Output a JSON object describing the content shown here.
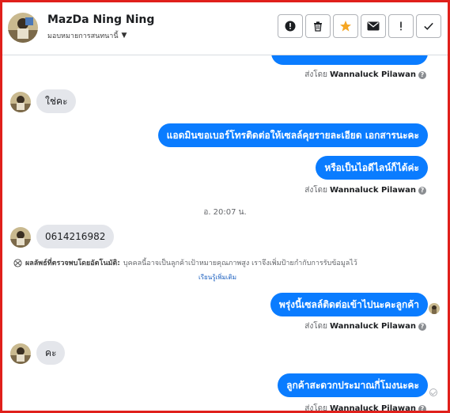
{
  "header": {
    "name": "MazDa Ning Ning",
    "subtitle": "มอบหมายการสนทนานี้",
    "toolbar": [
      "alert-circle-icon",
      "trash-icon",
      "star-icon",
      "mail-icon",
      "exclamation-icon",
      "check-icon"
    ]
  },
  "messages": {
    "sent_by_prefix": "ส่งโดย",
    "sender": "Wannaluck Pilawan",
    "m1": "ใช่คะ",
    "m2": "แอดมินขอเบอร์โทรติดต่อให้เซลล์คุยรายละเอียด เอกสารนะคะ",
    "m3": "หรือเป็นไอดีไลน์ก็ได้ค่ะ",
    "timestamp": "อ. 20:07 น.",
    "m4": "0614216982",
    "notice_bold": "ผลลัพธ์ที่ตรวจพบโดยอัตโนมัติ:",
    "notice_text": "บุคคลนี้อาจเป็นลูกค้าเป้าหมายคุณภาพสูง เราจึงเพิ่มป้ายกำกับการรับข้อมูลไว้",
    "learn_more": "เรียนรู้เพิ่มเติม",
    "m5": "พรุ่งนี้เซลล์ติดต่อเข้าไปนะคะลูกค้า",
    "m6": "คะ",
    "m7": "ลูกค้าสะดวกประมาณกี่โมงนะคะ"
  },
  "colors": {
    "accent": "#0a7cff",
    "incoming_bubble": "#e4e6eb",
    "frame": "#e0201b",
    "star": "#f5a623"
  }
}
